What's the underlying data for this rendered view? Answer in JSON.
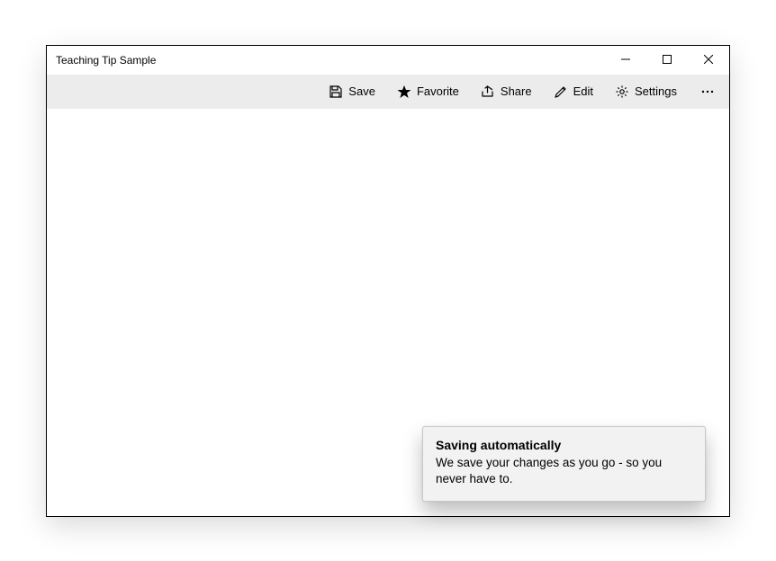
{
  "window": {
    "title": "Teaching Tip Sample"
  },
  "commands": {
    "save": "Save",
    "favorite": "Favorite",
    "share": "Share",
    "edit": "Edit",
    "settings": "Settings"
  },
  "teaching_tip": {
    "title": "Saving automatically",
    "body": "We save your changes as you go - so you never have to."
  }
}
